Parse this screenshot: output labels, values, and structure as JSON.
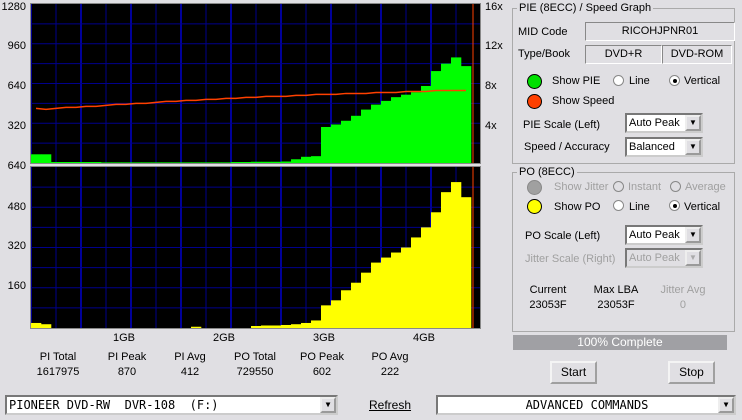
{
  "top_chart": {
    "left_ticks": [
      "1280",
      "960",
      "640",
      "320"
    ],
    "right_ticks": [
      "16x",
      "12x",
      "8x",
      "4x"
    ]
  },
  "bottom_chart": {
    "left_ticks": [
      "640",
      "480",
      "320",
      "160"
    ]
  },
  "x_ticks": [
    "1GB",
    "2GB",
    "3GB",
    "4GB"
  ],
  "chart_data": [
    {
      "type": "bar",
      "name": "PIE",
      "x_unit": "GB",
      "x_step": 0.1,
      "ylim": [
        0,
        1280
      ],
      "color": "#00ff00",
      "values": [
        70,
        70,
        8,
        8,
        8,
        8,
        8,
        5,
        5,
        5,
        5,
        5,
        5,
        5,
        5,
        5,
        5,
        5,
        5,
        5,
        8,
        8,
        10,
        10,
        10,
        12,
        30,
        50,
        55,
        290,
        310,
        340,
        380,
        430,
        470,
        500,
        530,
        550,
        570,
        620,
        740,
        800,
        850,
        780
      ]
    },
    {
      "type": "line",
      "name": "Speed",
      "x_step": 0.1,
      "ylim": [
        0,
        16
      ],
      "color": "#ff4000",
      "values": [
        5.5,
        5.4,
        5.5,
        5.6,
        5.6,
        5.7,
        5.7,
        5.8,
        5.9,
        5.9,
        6.0,
        6.0,
        6.1,
        6.2,
        6.2,
        6.3,
        6.3,
        6.4,
        6.4,
        6.5,
        6.5,
        6.6,
        6.6,
        6.7,
        6.7,
        6.7,
        6.8,
        6.8,
        6.9,
        6.9,
        6.9,
        7.0,
        7.0,
        7.0,
        7.1,
        7.1,
        7.1,
        7.2,
        7.2,
        7.2,
        7.3,
        7.3,
        7.3,
        7.3
      ]
    },
    {
      "type": "bar",
      "name": "PO",
      "x_unit": "GB",
      "x_step": 0.1,
      "ylim": [
        0,
        640
      ],
      "color": "#ffff00",
      "values": [
        20,
        15,
        0,
        0,
        0,
        0,
        0,
        0,
        0,
        0,
        0,
        0,
        0,
        0,
        0,
        0,
        5,
        0,
        0,
        0,
        0,
        0,
        8,
        10,
        10,
        12,
        15,
        20,
        30,
        90,
        110,
        150,
        180,
        220,
        260,
        280,
        300,
        320,
        360,
        400,
        460,
        540,
        580,
        520
      ]
    }
  ],
  "stats": [
    {
      "label": "PI Total",
      "value": "1617975"
    },
    {
      "label": "PI Peak",
      "value": "870"
    },
    {
      "label": "PI Avg",
      "value": "412"
    },
    {
      "label": "PO Total",
      "value": "729550"
    },
    {
      "label": "PO Peak",
      "value": "602"
    },
    {
      "label": "PO Avg",
      "value": "222"
    }
  ],
  "pie_panel": {
    "title": "PIE (8ECC) / Speed Graph",
    "mid_label": "MID Code",
    "mid_value": "RICOHJPNR01",
    "type_label": "Type/Book",
    "type_value": "DVD+R",
    "book_value": "DVD-ROM",
    "show_pie": "Show PIE",
    "show_speed": "Show Speed",
    "line": "Line",
    "vertical": "Vertical",
    "scale_label": "PIE Scale (Left)",
    "scale_value": "Auto Peak",
    "speed_label": "Speed / Accuracy",
    "speed_value": "Balanced",
    "pie_color": "#00e000",
    "speed_color": "#ff4000"
  },
  "po_panel": {
    "title": "PO (8ECC)",
    "show_jitter": "Show Jitter",
    "instant": "Instant",
    "average": "Average",
    "show_po": "Show PO",
    "line": "Line",
    "vertical": "Vertical",
    "scale_label": "PO Scale (Left)",
    "scale_value": "Auto Peak",
    "jitter_label": "Jitter Scale (Right)",
    "jitter_value": "Auto Peak",
    "current_label": "Current",
    "current_value": "23053F",
    "maxlba_label": "Max LBA",
    "maxlba_value": "23053F",
    "javg_label": "Jitter Avg",
    "javg_value": "0",
    "po_color": "#ffff00"
  },
  "progress": {
    "text": "100% Complete",
    "percent": 100
  },
  "buttons": {
    "start": "Start",
    "stop": "Stop",
    "refresh": "Refresh"
  },
  "drive": "PIONEER DVD-RW  DVR-108  (F:)",
  "commands": "ADVANCED COMMANDS"
}
